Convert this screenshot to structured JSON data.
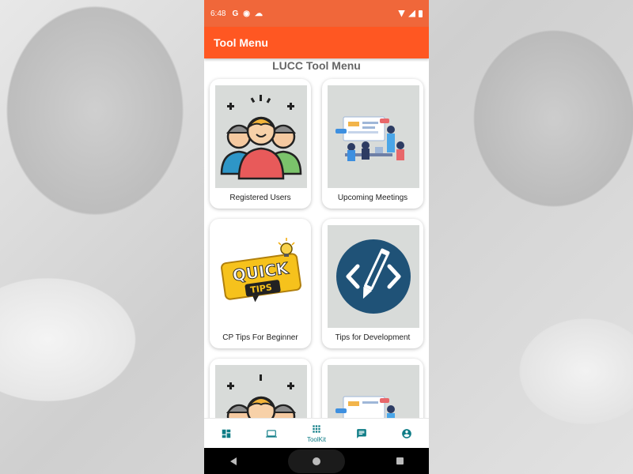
{
  "status_bar": {
    "time": "6:48",
    "icons": [
      "google-icon",
      "app-notification-icon",
      "cloud-icon",
      "wifi-icon",
      "signal-icon",
      "battery-icon"
    ]
  },
  "app_bar": {
    "title": "Tool Menu"
  },
  "page": {
    "heading": "LUCC Tool Menu"
  },
  "cards": [
    {
      "label": "Registered Users",
      "icon": "users-group-illustration"
    },
    {
      "label": "Upcoming Meetings",
      "icon": "meeting-illustration"
    },
    {
      "label": "CP Tips For Beginner",
      "icon": "quick-tips-illustration"
    },
    {
      "label": "Tips for Development",
      "icon": "code-pencil-illustration"
    },
    {
      "label": "",
      "icon": "users-group-illustration"
    },
    {
      "label": "",
      "icon": "meeting-illustration"
    }
  ],
  "quick_tips": {
    "line1": "QUICK",
    "line2": "TIPS"
  },
  "bottom_nav": [
    {
      "name": "dashboard",
      "label": "",
      "icon": "dashboard-icon"
    },
    {
      "name": "laptop",
      "label": "",
      "icon": "laptop-icon"
    },
    {
      "name": "toolkit",
      "label": "ToolKit",
      "icon": "grid-icon",
      "active": true
    },
    {
      "name": "chat",
      "label": "",
      "icon": "chat-icon"
    },
    {
      "name": "profile",
      "label": "",
      "icon": "account-icon"
    }
  ],
  "colors": {
    "status_bar": "#f0673a",
    "app_bar": "#ff5722",
    "nav_accent": "#0e7c86",
    "card_thumb_bg": "#d8dbd9"
  }
}
